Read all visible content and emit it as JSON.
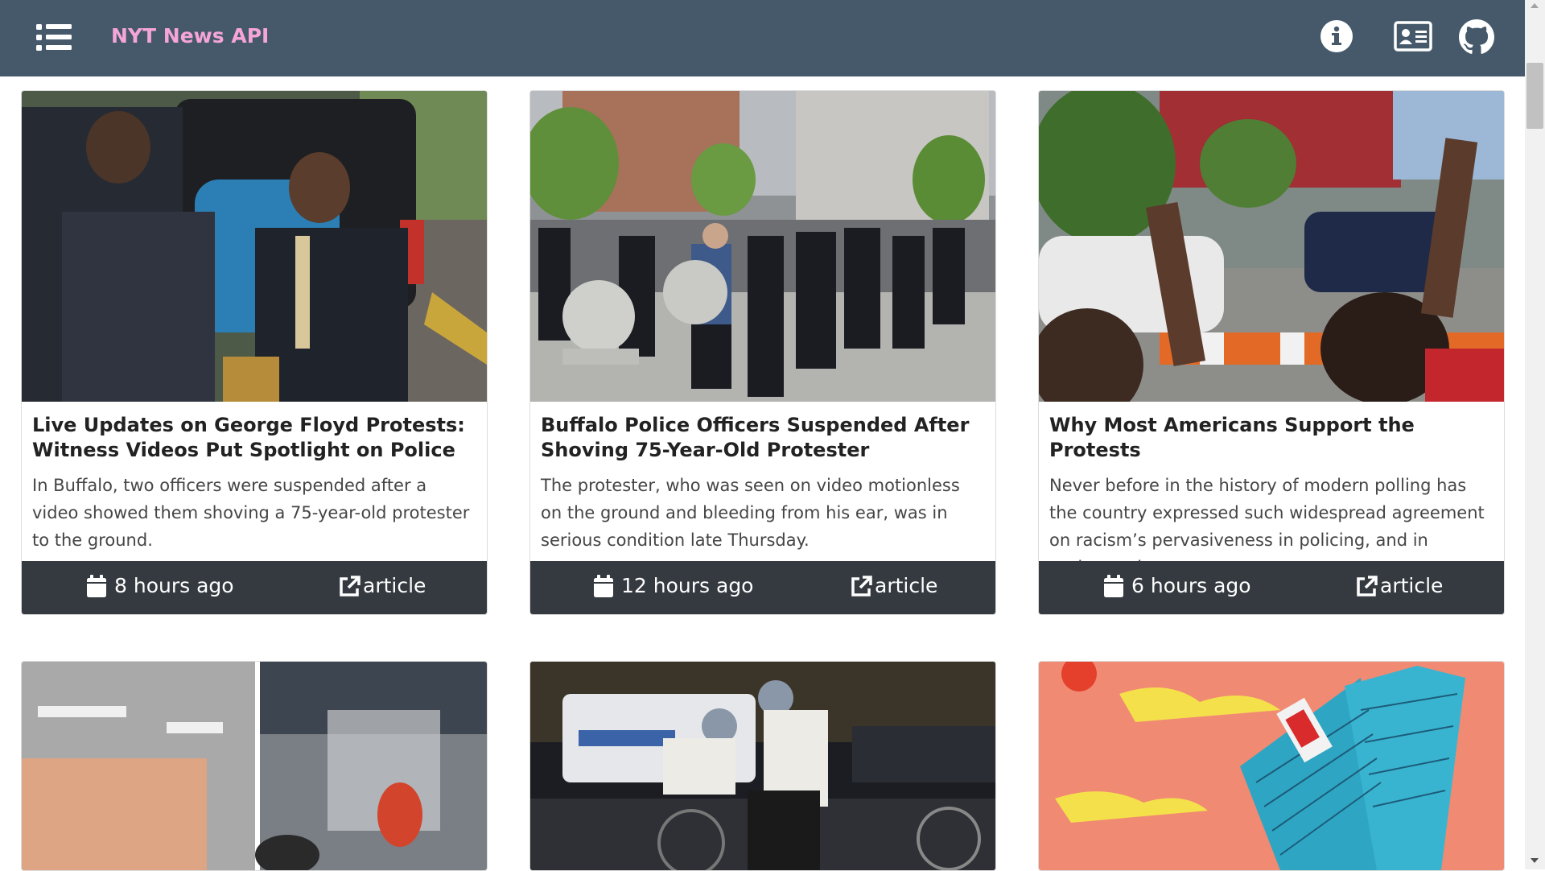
{
  "navbar": {
    "brand": "NYT News API",
    "menu_icon": "list-icon",
    "info_icon": "info-circle-icon",
    "contact_icon": "contact-card-icon",
    "github_icon": "github-icon",
    "brand_color": "#f6a5d8",
    "background_color": "#45596a"
  },
  "cards": [
    {
      "title": "Live Updates on George Floyd Protests: Witness Videos Put Spotlight on Police",
      "abstract": "In Buffalo, two officers were suspended after a video showed them shoving a 75-year-old protester to the ground.",
      "time": "8 hours ago",
      "link_label": "article"
    },
    {
      "title": "Buffalo Police Officers Suspended After Shoving 75-Year-Old Protester",
      "abstract": "The protester, who was seen on video motionless on the ground and bleeding from his ear, was in serious condition late Thursday.",
      "time": "12 hours ago",
      "link_label": "article"
    },
    {
      "title": "Why Most Americans Support the Protests",
      "abstract": "Never before in the history of modern polling has the country expressed such widespread agreement on racism’s pervasiveness in policing, and in society at large.",
      "time": "6 hours ago",
      "link_label": "article"
    }
  ],
  "footer_icons": {
    "time": "calendar-icon",
    "link": "external-link-icon"
  },
  "footer_color": "#343a40"
}
